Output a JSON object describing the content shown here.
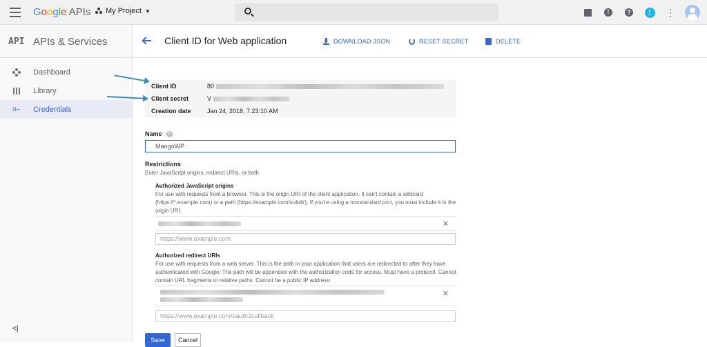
{
  "topbar": {
    "logo_letters": [
      "G",
      "o",
      "o",
      "g",
      "l",
      "e"
    ],
    "logo_suffix": " APIs",
    "project_name": "My Project",
    "notification_count": "1",
    "icons": [
      "gift-icon",
      "feedback-icon",
      "help-icon",
      "notifications-icon",
      "more-vert-icon",
      "avatar"
    ]
  },
  "sidebar": {
    "api_mark": "API",
    "title": "APIs & Services",
    "items": [
      {
        "label": "Dashboard",
        "icon": "dashboard-icon",
        "active": false
      },
      {
        "label": "Library",
        "icon": "library-icon",
        "active": false
      },
      {
        "label": "Credentials",
        "icon": "key-icon",
        "active": true
      }
    ],
    "collapse_label": "<|"
  },
  "header": {
    "title": "Client ID for Web application",
    "actions": {
      "download": "DOWNLOAD JSON",
      "reset": "RESET SECRET",
      "delete": "DELETE"
    }
  },
  "info": {
    "client_id_label": "Client ID",
    "client_id_value": "80",
    "client_secret_label": "Client secret",
    "client_secret_value": "V",
    "creation_label": "Creation date",
    "creation_value": "Jan 24, 2018, 7:23:10 AM"
  },
  "form": {
    "name_label": "Name",
    "name_value": "MangoWP",
    "restrictions_title": "Restrictions",
    "restrictions_sub": "Enter JavaScript origins, redirect URIs, or both",
    "js_origins": {
      "title": "Authorized JavaScript origins",
      "desc": "For use with requests from a browser. This is the origin URI of the client application. It can't contain a wildcard (https://*.example.com) or a path (https://example.com/subdir). If you're using a nonstandard port, you must include it in the origin URI.",
      "placeholder": "https://www.example.com"
    },
    "redirect_uris": {
      "title": "Authorized redirect URIs",
      "desc": "For use with requests from a web server. This is the path in your application that users are redirected to after they have authenticated with Google. The path will be appended with the authorization code for access. Must have a protocol. Cannot contain URL fragments or relative paths. Cannot be a public IP address.",
      "placeholder": "https://www.example.com/oauth2callback"
    },
    "save_label": "Save",
    "cancel_label": "Cancel"
  },
  "colors": {
    "accent": "#3367d6",
    "annotation_arrow": "#3c8dbc"
  }
}
